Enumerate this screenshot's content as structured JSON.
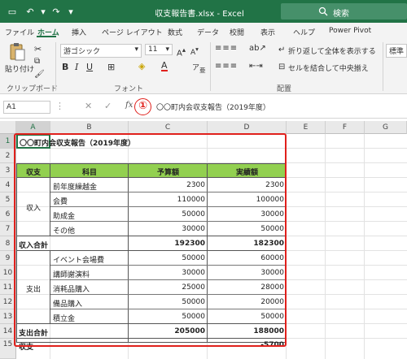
{
  "titlebar": {
    "title": "収支報告書.xlsx  -  Excel",
    "search_label": "検索",
    "undo_icon": "↶",
    "redo_icon": "↷",
    "save_icon": "▭",
    "customize_icon": "▾"
  },
  "menu": {
    "items": [
      "ファイル",
      "ホーム",
      "挿入",
      "ページ レイアウト",
      "数式",
      "データ",
      "校閲",
      "表示",
      "ヘルプ",
      "Power Pivot"
    ]
  },
  "ribbon": {
    "paste_label": "貼り付け",
    "clipboard_group": "クリップボード",
    "font_name": "游ゴシック",
    "font_size": "11",
    "font_group": "フォント",
    "bold": "B",
    "italic": "I",
    "underline": "U",
    "wrap_text": "折り返して全体を表示する",
    "merge_center": "セルを結合して中央揃え",
    "alignment_group": "配置",
    "number_format": "標準"
  },
  "formula_bar": {
    "cell_ref": "A1",
    "fx_label": "fx",
    "cancel": "✕",
    "enter": "✓",
    "content": "〇〇町内会収支報告（2019年度）"
  },
  "callout": {
    "label": "①"
  },
  "columns": [
    "A",
    "B",
    "C",
    "D",
    "E",
    "F",
    "G"
  ],
  "rows": [
    "1",
    "2",
    "3",
    "4",
    "5",
    "6",
    "7",
    "8",
    "9",
    "10",
    "11",
    "12",
    "13",
    "14",
    "15"
  ],
  "sheet": {
    "title": "〇〇町内会収支報告（2019年度）",
    "headers": {
      "a": "収支",
      "b": "科目",
      "c": "予算額",
      "d": "実績額"
    },
    "income_label": "収入",
    "income_items": [
      {
        "name": "前年度繰越金",
        "budget": "2300",
        "actual": "2300"
      },
      {
        "name": "会費",
        "budget": "110000",
        "actual": "100000"
      },
      {
        "name": "助成金",
        "budget": "50000",
        "actual": "30000"
      },
      {
        "name": "その他",
        "budget": "30000",
        "actual": "50000"
      }
    ],
    "income_total": {
      "label": "収入合計",
      "budget": "192300",
      "actual": "182300"
    },
    "expense_label": "支出",
    "expense_items": [
      {
        "name": "イベント会場費",
        "budget": "50000",
        "actual": "60000"
      },
      {
        "name": "講師謝演料",
        "budget": "30000",
        "actual": "30000"
      },
      {
        "name": "消耗品購入",
        "budget": "25000",
        "actual": "28000"
      },
      {
        "name": "備品購入",
        "budget": "50000",
        "actual": "20000"
      },
      {
        "name": "積立金",
        "budget": "50000",
        "actual": "50000"
      }
    ],
    "expense_total": {
      "label": "支出合計",
      "budget": "205000",
      "actual": "188000"
    },
    "balance": {
      "label": "収支",
      "actual": "-5700"
    }
  },
  "colors": {
    "excel_green": "#217346",
    "header_fill": "#92d050",
    "callout_red": "#e0201c"
  }
}
